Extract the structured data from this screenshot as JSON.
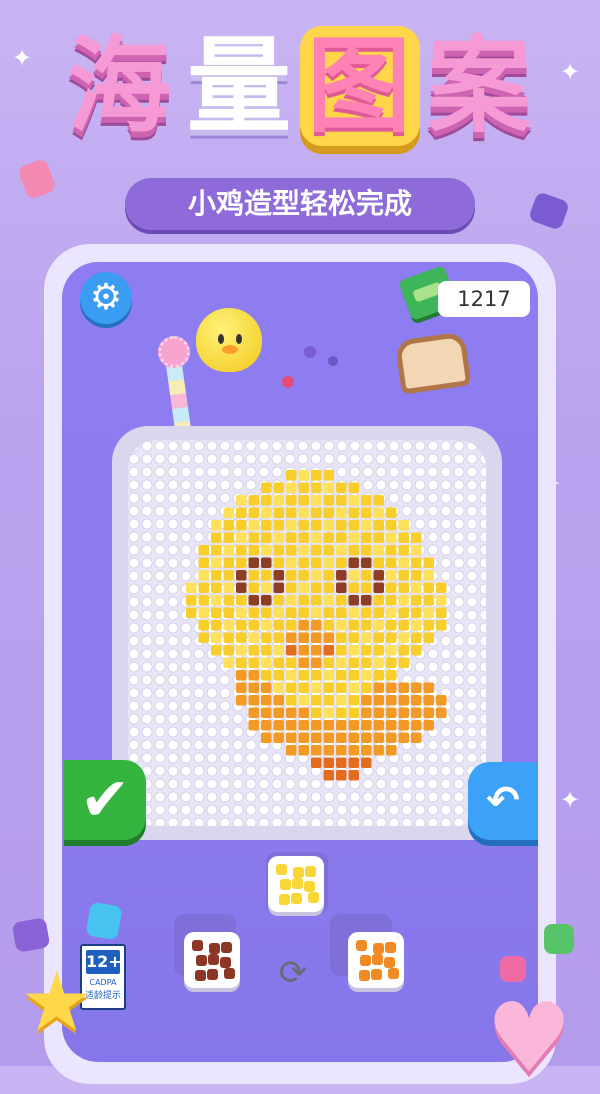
{
  "banner": {
    "title_chars": [
      "海",
      "量",
      "图",
      "案"
    ],
    "subtitle": "小鸡造型轻松完成"
  },
  "hud": {
    "settings_icon": "gear-icon",
    "coins": "1217",
    "money_icon": "cash-stack-icon"
  },
  "board": {
    "pattern": "chick",
    "colors": {
      "yellow": "#f8cf2a",
      "light_yellow": "#fde15a",
      "orange": "#f39a24",
      "dark_orange": "#e36c1e",
      "brown": "#8e3e24",
      "peg_board": "#e8e5f6"
    }
  },
  "controls": {
    "confirm_icon": "checkmark-icon",
    "undo_icon": "undo-arrow-icon",
    "shuffle_icon": "refresh-icon"
  },
  "bead_trays": [
    {
      "name": "yellow-tray",
      "color": "#f8d635"
    },
    {
      "name": "brown-tray",
      "color": "#8c3726"
    },
    {
      "name": "orange-tray",
      "color": "#f08a25"
    }
  ],
  "rating": {
    "age": "12+",
    "org": "CADPA",
    "label": "适龄提示"
  }
}
